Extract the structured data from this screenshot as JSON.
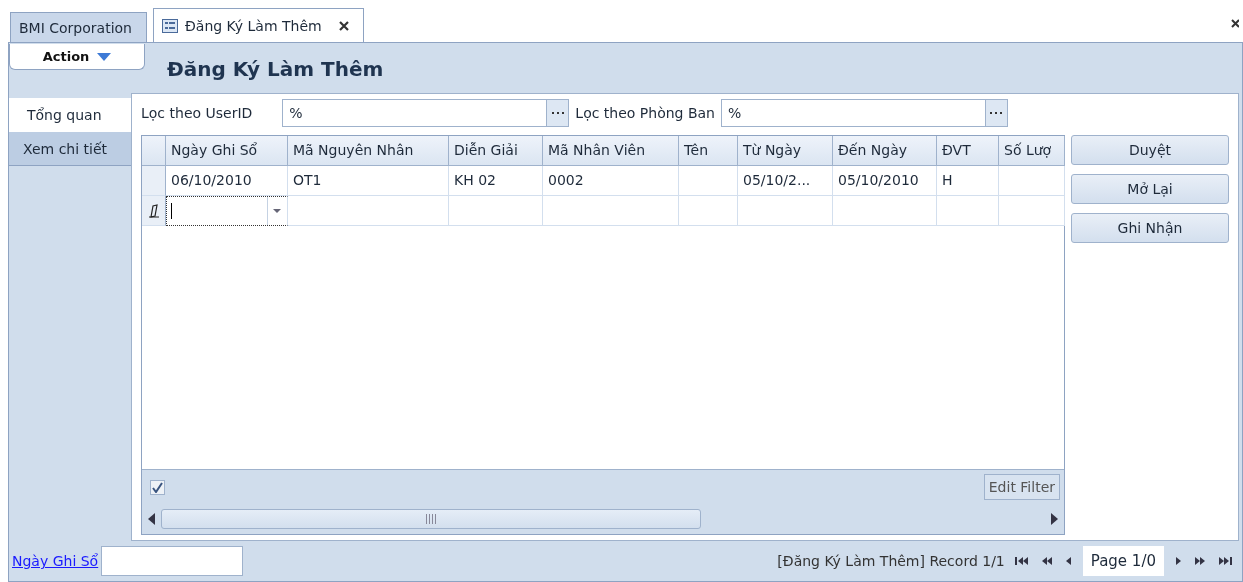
{
  "doc_tabs": [
    {
      "label": "BMI Corporation",
      "selected": false,
      "icon": false,
      "closable": false
    },
    {
      "label": "Đăng Ký Làm Thêm",
      "selected": true,
      "icon": true,
      "closable": true
    }
  ],
  "action_menu": {
    "label": "Action"
  },
  "title": "Đăng Ký Làm Thêm",
  "side_tabs": [
    {
      "label": "Tổng quan",
      "selected": true
    },
    {
      "label": "Xem chi tiết",
      "selected": false
    }
  ],
  "filters": [
    {
      "label": "Lọc theo UserID",
      "value": "%"
    },
    {
      "label": "Lọc theo Phòng Ban",
      "value": "%"
    }
  ],
  "grid": {
    "columns": [
      "Ngày Ghi Sổ",
      "Mã Nguyên Nhân",
      "Diễn Giải",
      "Mã Nhân Viên",
      "Tên",
      "Từ Ngày",
      "Đến Ngày",
      "ĐVT",
      "Số Lượ"
    ],
    "rows": [
      [
        "06/10/2010",
        "OT1",
        "KH 02",
        "0002",
        "",
        "05/10/2...",
        "05/10/2010",
        "H",
        ""
      ]
    ],
    "new_row": {
      "editing": true
    },
    "filter_enabled": {
      "checked": true
    },
    "edit_filter": "Edit Filter"
  },
  "buttons": [
    "Duyệt",
    "Mở Lại",
    "Ghi Nhận"
  ],
  "footer": {
    "link": "Ngày Ghi Sổ",
    "record": "[Đăng Ký Làm Thêm] Record 1/1",
    "page": "Page 1/0"
  }
}
